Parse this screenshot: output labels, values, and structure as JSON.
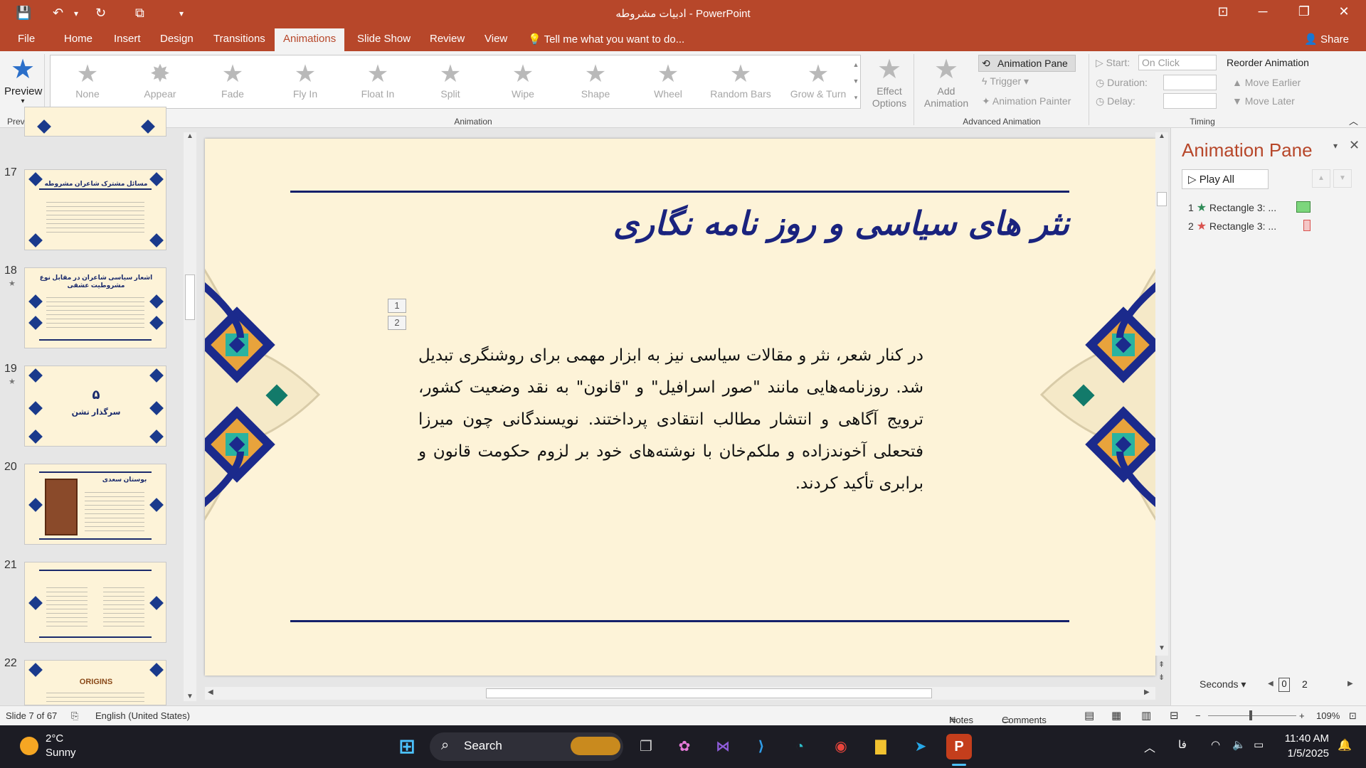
{
  "window": {
    "title": "ادبیات مشروطه - PowerPoint"
  },
  "menu": {
    "tabs": [
      "File",
      "Home",
      "Insert",
      "Design",
      "Transitions",
      "Animations",
      "Slide Show",
      "Review",
      "View"
    ],
    "active_tab": "Animations",
    "tell_me": "Tell me what you want to do...",
    "share": "Share"
  },
  "ribbon": {
    "preview": {
      "label": "Preview",
      "group": "Preview"
    },
    "animations": [
      "None",
      "Appear",
      "Fade",
      "Fly In",
      "Float In",
      "Split",
      "Wipe",
      "Shape",
      "Wheel",
      "Random Bars",
      "Grow & Turn"
    ],
    "effect_options": "Effect\nOptions",
    "animation_group": "Animation",
    "add_animation": "Add\nAnimation",
    "animation_pane_btn": "Animation Pane",
    "trigger": "Trigger",
    "animation_painter": "Animation Painter",
    "advanced_group": "Advanced Animation",
    "start_label": "Start:",
    "start_value": "On Click",
    "duration_label": "Duration:",
    "delay_label": "Delay:",
    "reorder": "Reorder Animation",
    "move_earlier": "Move Earlier",
    "move_later": "Move Later",
    "timing_group": "Timing"
  },
  "thumbnails": [
    {
      "num": "17",
      "star": false,
      "title": "مسائل مشترک شاعران مشروطه"
    },
    {
      "num": "18",
      "star": true,
      "title": "اشعار سیاسی شاعران در مقابل نوع مشروطیت عشقی"
    },
    {
      "num": "19",
      "star": true,
      "title": "سرگذار تشن"
    },
    {
      "num": "20",
      "star": false,
      "title": "بوستان سعدی"
    },
    {
      "num": "21",
      "star": false,
      "title": ""
    },
    {
      "num": "22",
      "star": false,
      "title": "ORIGINS"
    }
  ],
  "slide": {
    "title": "نثر های سیاسی و روز نامه نگاری",
    "body": "در کنار شعر، نثر و مقالات سیاسی نیز به ابزار مهمی برای روشنگری تبدیل شد. روزنامه‌هایی مانند \"صور اسرافیل\" و \"قانون\" به نقد وضعیت کشور، ترویج آگاهی و انتشار مطالب انتقادی پرداختند. نویسندگانی چون میرزا فتحعلی آخوندزاده و ملکم‌خان با نوشته‌های خود بر لزوم حکومت قانون و برابری تأکید کردند.",
    "anim_tags": [
      "1",
      "2"
    ]
  },
  "animation_pane": {
    "title": "Animation Pane",
    "play_all": "Play All",
    "items": [
      {
        "num": "1",
        "label": "Rectangle 3: ...",
        "color": "#2e8b57",
        "box": "#7cd67c"
      },
      {
        "num": "2",
        "label": "Rectangle 3: ...",
        "color": "#d9534f",
        "box": "#f4c6c6"
      }
    ],
    "seconds": "Seconds",
    "timeline_start": "0",
    "timeline_mark": "2"
  },
  "status": {
    "slide": "Slide 7 of 67",
    "language": "English (United States)",
    "notes": "Notes",
    "comments": "Comments",
    "zoom": "109%"
  },
  "taskbar": {
    "weather_temp": "2°C",
    "weather_desc": "Sunny",
    "search": "Search",
    "lang": "فا",
    "time": "11:40 AM",
    "date": "1/5/2025"
  }
}
